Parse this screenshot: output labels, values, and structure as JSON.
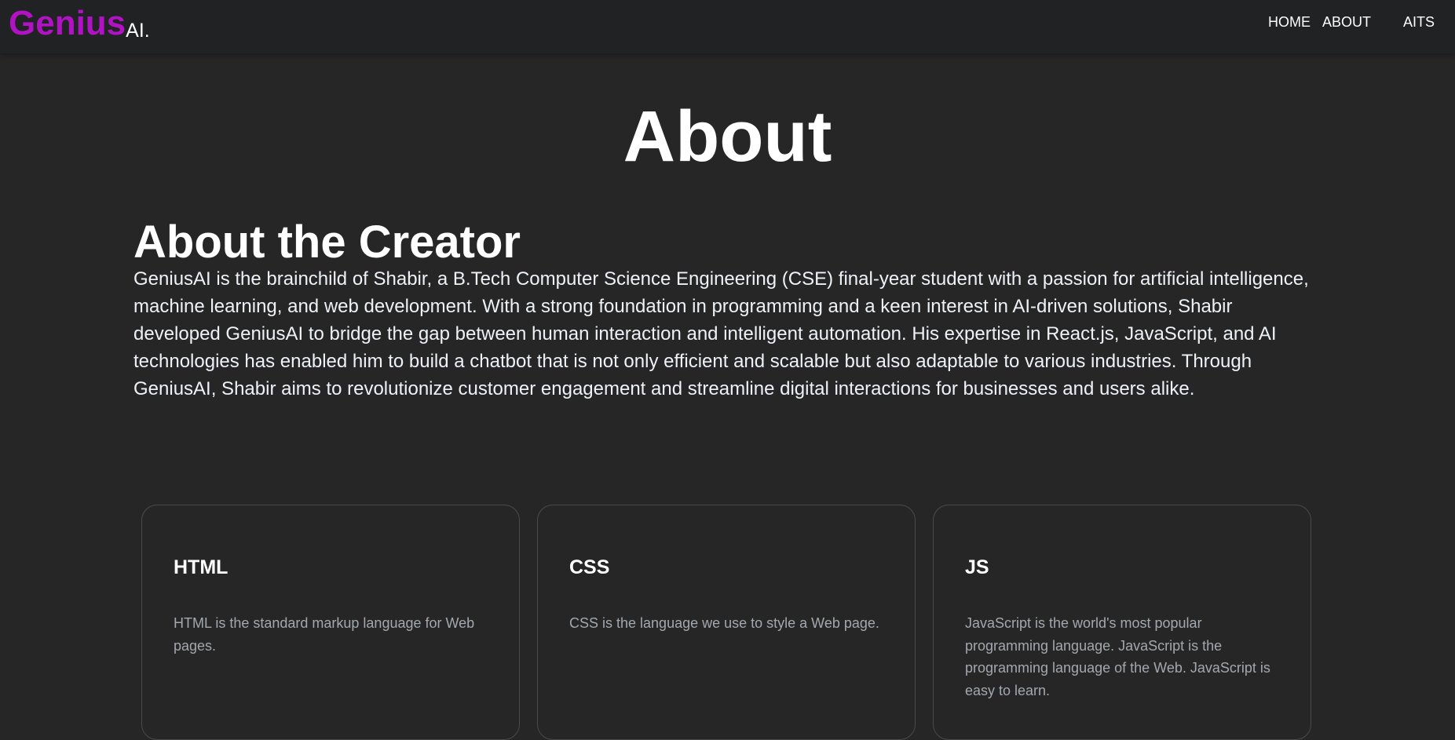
{
  "nav": {
    "logo_main": "Genius",
    "logo_suffix": "AI.",
    "links": [
      "HOME",
      "ABOUT",
      "AITS"
    ]
  },
  "page": {
    "title": "About"
  },
  "creator": {
    "heading": "About the Creator",
    "text": "GeniusAI is the brainchild of Shabir, a B.Tech Computer Science Engineering (CSE) final-year student with a passion for artificial intelligence, machine learning, and web development. With a strong foundation in programming and a keen interest in AI-driven solutions, Shabir developed GeniusAI to bridge the gap between human interaction and intelligent automation. His expertise in React.js, JavaScript, and AI technologies has enabled him to build a chatbot that is not only efficient and scalable but also adaptable to various industries. Through GeniusAI, Shabir aims to revolutionize customer engagement and streamline digital interactions for businesses and users alike."
  },
  "cards": [
    {
      "title": "HTML",
      "text": "HTML is the standard markup language for Web pages."
    },
    {
      "title": "CSS",
      "text": "CSS is the language we use to style a Web page."
    },
    {
      "title": "JS",
      "text": "JavaScript is the world's most popular programming language. JavaScript is the programming language of the Web. JavaScript is easy to learn."
    }
  ],
  "colors": {
    "brand": "#b012c4",
    "background": "#262626",
    "navbar": "#212223",
    "muted_text": "#a3a8ad"
  }
}
